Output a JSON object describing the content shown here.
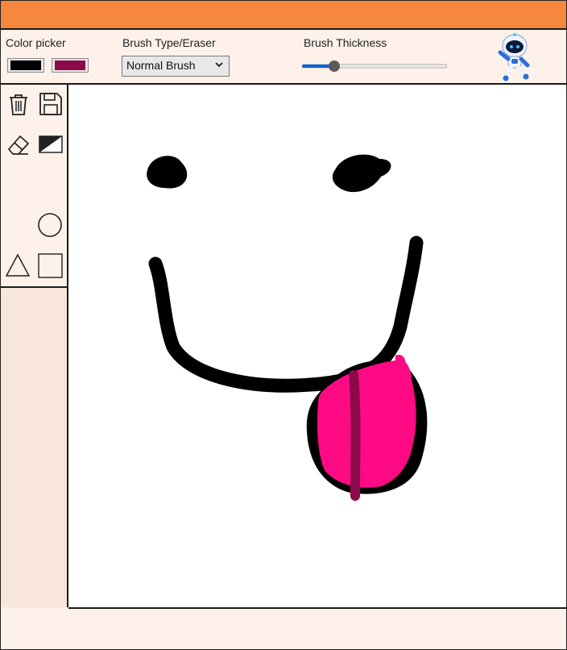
{
  "toolbar": {
    "color_picker_label": "Color picker",
    "brush_type_label": "Brush Type/Eraser",
    "brush_type_value": "Normal Brush",
    "thickness_label": "Brush Thickness",
    "thickness_level": 0.22
  },
  "colors": {
    "primary": "#000000",
    "secondary": "#8b0a4a",
    "pink": "#ff0a85",
    "titlebar": "#f5873f"
  },
  "tools": [
    "trash-icon",
    "save-icon",
    "eraser-icon",
    "fill-contrast-icon",
    "circle-icon",
    "triangle-icon",
    "square-icon"
  ]
}
